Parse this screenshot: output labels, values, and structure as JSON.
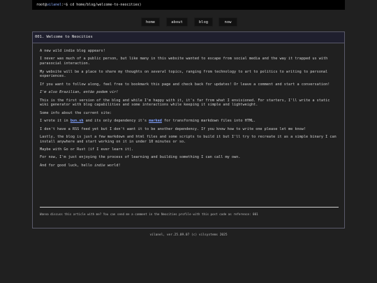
{
  "terminal": {
    "user": "root",
    "host": "vilanel",
    "rest": ":~$ cd home/blog/welcome-to-neocities)"
  },
  "nav": {
    "items": [
      {
        "label": "home"
      },
      {
        "label": "about"
      },
      {
        "label": "blog"
      },
      {
        "label": "now"
      }
    ]
  },
  "article": {
    "title": "001. Welcome to Neocities",
    "p1": "A new wild indie blog appears!",
    "p2": "I never was much of a public person, but like many in this website wanted to escape from social media and the way it trapped us with parasocial interaction.",
    "p3a": "My website will be a place to share my thoughts on ",
    "p3em": "several",
    "p3b": " topics, ranging from technology to art to politics to writing to personal experiences.",
    "p4": "If you want to follow along, feel free to bookmark this page and check back for updates! Or leave a comment and start a conversation!",
    "p5": "I'm also Brazilian, então podem vir!",
    "p6": "This is the first version of the blog and while I'm happy with it, it's far from what I envisioned. For starters, I'll write a static wiki generator with blog capabilities and some interactions while keeping it simple and lightweight.",
    "p7": "Some info about the current site:",
    "p8a": "I wrote it in ",
    "p8link1": "bun.sh",
    "p8b": " and its only dependency it's ",
    "p8link2": "marked",
    "p8c": " for transforming markdown files into HTML.",
    "p9": "I don't have a RSS feed yet but I don't want it to be another dependency. If you know how to write one please let me know!",
    "p10": "Lastly, the blog is just a few markdown and html files and some scripts to build it but I'll try to recreate it as a simple binary I can install anywhere and start working on it in under 10 minutes or so.",
    "p11": "Maybe with Go or Rust (if I ever learn it).",
    "p12": "For now, I'm just enjoying the process of learning and building something I can call my own.",
    "p13a": "And for good luck, hello ",
    "p13em": "indie",
    "p13b": " world!",
    "footnote": "Wanna discuss this article with me? You can send me a comment in the Neocities profile with this post code as reference: 001"
  },
  "footer": {
    "text": "vilanel, ver.25.09.07 (c) vilsystems 2025"
  }
}
